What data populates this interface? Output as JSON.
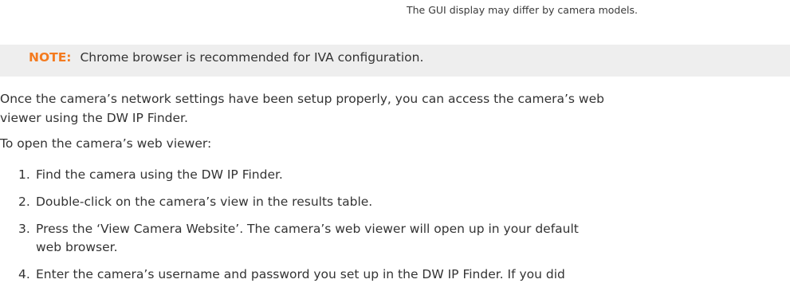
{
  "caption": "The GUI display may differ by camera models.",
  "note": {
    "label": "NOTE:",
    "text": "Chrome browser is recommended for IVA configuration.",
    "label_color": "#f47b20"
  },
  "paragraph1": {
    "line1": "Once the camera’s network settings have been setup properly, you can access the camera’s web",
    "line2": "viewer using the DW IP Finder."
  },
  "paragraph2": "To open the camera’s web viewer:",
  "steps": [
    {
      "num": "1.",
      "line1": "Find the camera using the DW IP Finder."
    },
    {
      "num": "2.",
      "line1": "Double-click on the camera’s view in the results table."
    },
    {
      "num": "3.",
      "line1": "Press the ‘View Camera Website’. The camera’s web viewer will open up in your default",
      "line2": "web browser."
    },
    {
      "num": "4.",
      "line1": "Enter the camera’s username and password you set up in the DW IP Finder. If you did"
    }
  ]
}
